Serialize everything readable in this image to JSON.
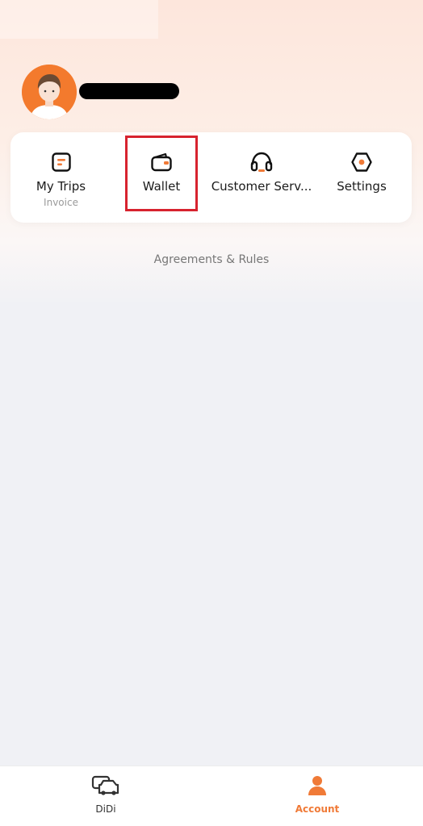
{
  "header": {
    "avatar": "user-avatar",
    "username": ""
  },
  "quick_actions": {
    "items": [
      {
        "label": "My Trips",
        "sublabel": "Invoice",
        "icon": "trips-icon"
      },
      {
        "label": "Wallet",
        "sublabel": "",
        "icon": "wallet-icon"
      },
      {
        "label": "Customer Serv...",
        "sublabel": "",
        "icon": "headset-icon"
      },
      {
        "label": "Settings",
        "sublabel": "",
        "icon": "settings-icon"
      }
    ]
  },
  "links": {
    "agreements": "Agreements & Rules"
  },
  "bottom_nav": {
    "items": [
      {
        "label": "DiDi",
        "icon": "didi-car-icon",
        "active": false
      },
      {
        "label": "Account",
        "icon": "person-icon",
        "active": true
      }
    ]
  },
  "colors": {
    "accent": "#f07a37",
    "highlight": "#d7232f"
  }
}
